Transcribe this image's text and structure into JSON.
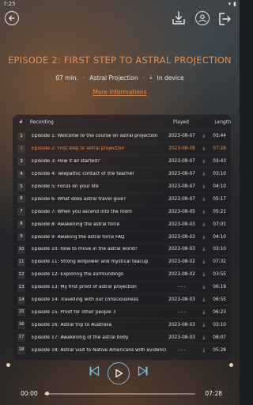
{
  "status": {
    "time": "7:25"
  },
  "episode": {
    "title": "EPISODE 2: FIRST STEP TO ASTRAL PROJECTION",
    "duration": "07 min.",
    "category": "Astral Projection",
    "storage": "In device",
    "more_info": "More informations"
  },
  "table": {
    "headers": {
      "num": "#",
      "recording": "Recording",
      "played": "Played",
      "length": "Length"
    },
    "rows": [
      {
        "num": "1",
        "title": "Episode 1: Welcome to the course on astral projection",
        "played": "2023-08-07",
        "length": "03:44"
      },
      {
        "num": "2",
        "title": "Episode 2: First step to astral projection",
        "played": "2023-08-08",
        "length": "07:28",
        "active": true
      },
      {
        "num": "3",
        "title": "Episode 3: How it all started?",
        "played": "2023-08-07",
        "length": "03:43"
      },
      {
        "num": "4",
        "title": "Episode 4: Telepathic contact of the teacher",
        "played": "2023-08-07",
        "length": "03:10"
      },
      {
        "num": "5",
        "title": "Episode 5: Focus on your life",
        "played": "2023-08-07",
        "length": "04:10"
      },
      {
        "num": "6",
        "title": "Episode 6: What does astral travel give?",
        "played": "2023-08-07",
        "length": "05:17"
      },
      {
        "num": "7",
        "title": "Episode 7: When you ascend into the room",
        "played": "2023-08-05",
        "length": "05:21"
      },
      {
        "num": "8",
        "title": "Episode 8: Awakening the astral force",
        "played": "2023-08-03",
        "length": "07:01"
      },
      {
        "num": "9",
        "title": "Episode 9: Awaking the astral force FAQ",
        "played": "2023-08-03",
        "length": "04:10"
      },
      {
        "num": "10",
        "title": "Episode 10: How to move in the astral world?",
        "played": "2023-08-03",
        "length": "03:10"
      },
      {
        "num": "11",
        "title": "Episode 11: Strong willpower and mystical teacup",
        "played": "2023-08-02",
        "length": "07:32"
      },
      {
        "num": "12",
        "title": "Episode 12: Exploring the surroundings",
        "played": "2023-08-02",
        "length": "03:55"
      },
      {
        "num": "13",
        "title": "Episode 13: My first proof of astral projection",
        "played": "- - -",
        "length": "06:19"
      },
      {
        "num": "14",
        "title": "Episode 14: Travelling with our consciousness",
        "played": "2023-08-03",
        "length": "06:55"
      },
      {
        "num": "15",
        "title": "Episode 15: Proof for other people 3",
        "played": "- - -",
        "length": "06:23"
      },
      {
        "num": "16",
        "title": "Episode 16: Astral trip to Australia",
        "played": "2023-08-03",
        "length": "03:10"
      },
      {
        "num": "17",
        "title": "Episode 17: Awakening of the astral body",
        "played": "2023-08-03",
        "length": "08:07"
      },
      {
        "num": "18",
        "title": "Episode 18: Astral visit to Native Americans with evidence",
        "played": "- - -",
        "length": "05:28"
      }
    ]
  },
  "player": {
    "current_time": "00:00",
    "total_time": "07:28",
    "progress": 0
  },
  "colors": {
    "accent": "#e98d4d",
    "play_ring": "#7ab8d9"
  }
}
